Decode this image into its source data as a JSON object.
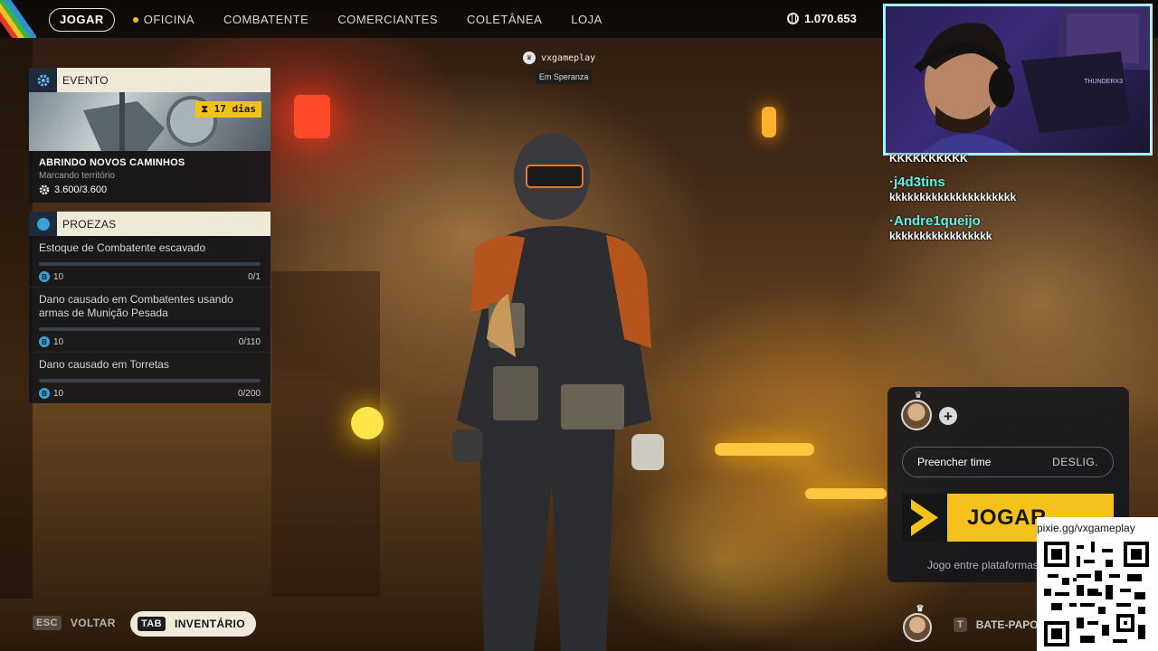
{
  "nav": {
    "items": [
      {
        "label": "JOGAR",
        "active": true
      },
      {
        "label": "OFICINA",
        "dot": true
      },
      {
        "label": "COMBATENTE"
      },
      {
        "label": "COMERCIANTES"
      },
      {
        "label": "COLETÂNEA"
      },
      {
        "label": "LOJA"
      }
    ],
    "credits": "1.070.653"
  },
  "event": {
    "header": "EVENTO",
    "days": "17 dias",
    "title": "ABRINDO NOVOS CAMINHOS",
    "subtitle": "Marcando território",
    "progress": "3.600/3.600"
  },
  "feats": {
    "header": "PROEZAS",
    "items": [
      {
        "name": "Estoque de Combatente escavado",
        "reward": "10",
        "progress": "0/1",
        "fraction": 0
      },
      {
        "name": "Dano causado em Combatentes usando armas de Munição Pesada",
        "reward": "10",
        "progress": "0/110",
        "fraction": 0
      },
      {
        "name": "Dano causado em Torretas",
        "reward": "10",
        "progress": "0/200",
        "fraction": 0
      }
    ]
  },
  "player": {
    "name": "vxgameplay",
    "location": "Em Speranza"
  },
  "webcam": {
    "brand": "THUNDERX3"
  },
  "chat": {
    "lines": [
      {
        "type": "msg",
        "text": "KKKKKKKKKK"
      },
      {
        "type": "user",
        "text": "·j4d3tins"
      },
      {
        "type": "msg",
        "text": "kkkkkkkkkkkkkkkkkkkkk"
      },
      {
        "type": "user",
        "text": "·Andre1queijo"
      },
      {
        "type": "msg",
        "text": "kkkkkkkkkkkkkkkkk"
      }
    ]
  },
  "party": {
    "fill_label": "Preencher time",
    "fill_value": "DESLIG.",
    "play_label": "JOGAR",
    "crossplay": "Jogo entre plataformas"
  },
  "qr": {
    "url": "pixie.gg/vxgameplay"
  },
  "bottom": {
    "back_key": "ESC",
    "back_label": "VOLTAR",
    "inv_key": "TAB",
    "inv_label": "INVENTÁRIO",
    "chat_key": "T",
    "chat_label": "BATE-PAPO"
  },
  "colors": {
    "accent_yellow": "#f4c21b",
    "panel_header": "#efe9d8",
    "chat_user": "#5ef0e6",
    "webcam_border": "#a6f3ff"
  }
}
